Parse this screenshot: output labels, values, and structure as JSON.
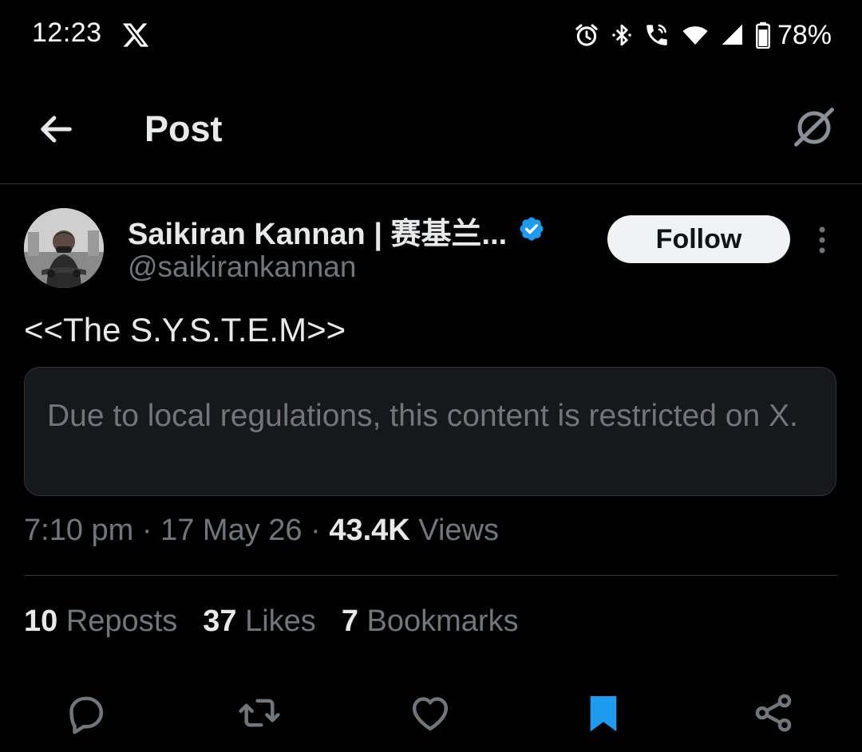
{
  "status_bar": {
    "time": "12:23",
    "battery": "78%",
    "icons": [
      "x-logo-icon",
      "alarm-icon",
      "bluetooth-icon",
      "wifi-calling-icon",
      "wifi-icon",
      "cellular-signal-icon",
      "battery-icon"
    ]
  },
  "header": {
    "title": "Post",
    "back_icon": "arrow-left-icon",
    "grok_icon": "grok-icon"
  },
  "post": {
    "author_name": "Saikiran Kannan | 赛基兰...",
    "verified": true,
    "handle": "@saikirankannan",
    "follow_label": "Follow",
    "text": "<<The S.Y.S.T.E.M>>",
    "restricted_notice": "Due to local regulations, this content is restricted on X.",
    "time": "7:10 pm",
    "date": "17 May 26",
    "separator": " · ",
    "views_count": "43.4K",
    "views_label": "Views"
  },
  "stats": {
    "reposts_count": "10",
    "reposts_label": "Reposts",
    "likes_count": "37",
    "likes_label": "Likes",
    "bookmarks_count": "7",
    "bookmarks_label": "Bookmarks"
  },
  "actions": [
    "reply-icon",
    "repost-icon",
    "like-icon",
    "bookmark-icon",
    "share-icon"
  ],
  "colors": {
    "background": "#000000",
    "primary_text": "#e7e9ea",
    "secondary_text": "#71767b",
    "border": "#2f3336",
    "accent_blue": "#1d9bf0",
    "card_bg": "#16181c"
  }
}
